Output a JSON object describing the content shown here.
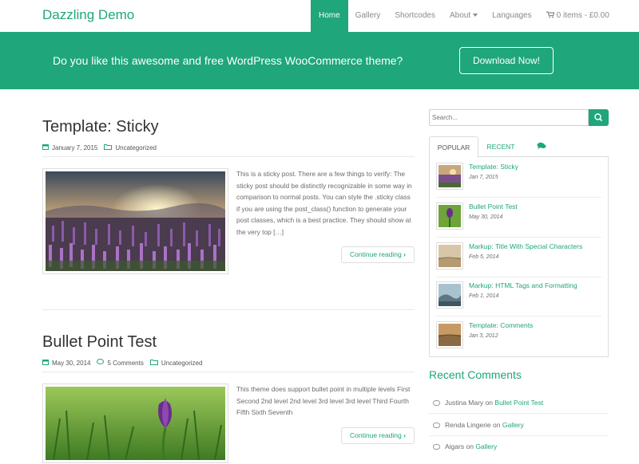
{
  "site": {
    "brand": "Dazzling Demo"
  },
  "nav": {
    "items": [
      "Home",
      "Gallery",
      "Shortcodes",
      "About",
      "Languages"
    ],
    "cart": "0 items - £0.00"
  },
  "banner": {
    "text": "Do you like this awesome and free WordPress WooCommerce theme?",
    "button": "Download Now!"
  },
  "posts": [
    {
      "title": "Template: Sticky",
      "date": "January 7, 2015",
      "comments": "",
      "category": "Uncategorized",
      "excerpt": "This is a sticky post. There are a few things to verify: The sticky post should be distinctly recognizable in some way in comparison to normal posts. You can style the .sticky class if you are using the post_class() function to generate your post classes, which is a best practice. They should show at the very top […]",
      "continue": "Continue reading"
    },
    {
      "title": "Bullet Point Test",
      "date": "May 30, 2014",
      "comments": "5 Comments",
      "category": "Uncategorized",
      "excerpt": "This theme does support bullet point in multiple levels First Second 2nd level 2nd level 3rd level 3rd level Third Fourth Fifth Sixth Seventh",
      "continue": "Continue reading"
    }
  ],
  "sidebar": {
    "search_placeholder": "Search...",
    "tabs": [
      "POPULAR",
      "RECENT"
    ],
    "popular": [
      {
        "title": "Template: Sticky",
        "date": "Jan 7, 2015"
      },
      {
        "title": "Bullet Point Test",
        "date": "May 30, 2014"
      },
      {
        "title": "Markup: Title With Special Characters",
        "date": "Feb 5, 2014"
      },
      {
        "title": "Markup: HTML Tags and Formatting",
        "date": "Feb 1, 2014"
      },
      {
        "title": "Template: Comments",
        "date": "Jan 3, 2012"
      }
    ],
    "recent_comments_title": "Recent Comments",
    "recent_comments": [
      {
        "author": "Justina Mary",
        "on": "on",
        "post": "Bullet Point Test"
      },
      {
        "author": "Renda Lingerie",
        "on": "on",
        "post": "Gallery"
      },
      {
        "author": "Aigars",
        "on": "on",
        "post": "Gallery"
      }
    ]
  },
  "colors": {
    "accent": "#1fa67a",
    "text": "#6b6b6b",
    "heading": "#333333"
  },
  "icons": {
    "calendar": "calendar-icon",
    "folder": "folder-icon",
    "comment": "comment-icon",
    "cart": "cart-icon",
    "chevron": "chevron-right-icon"
  }
}
